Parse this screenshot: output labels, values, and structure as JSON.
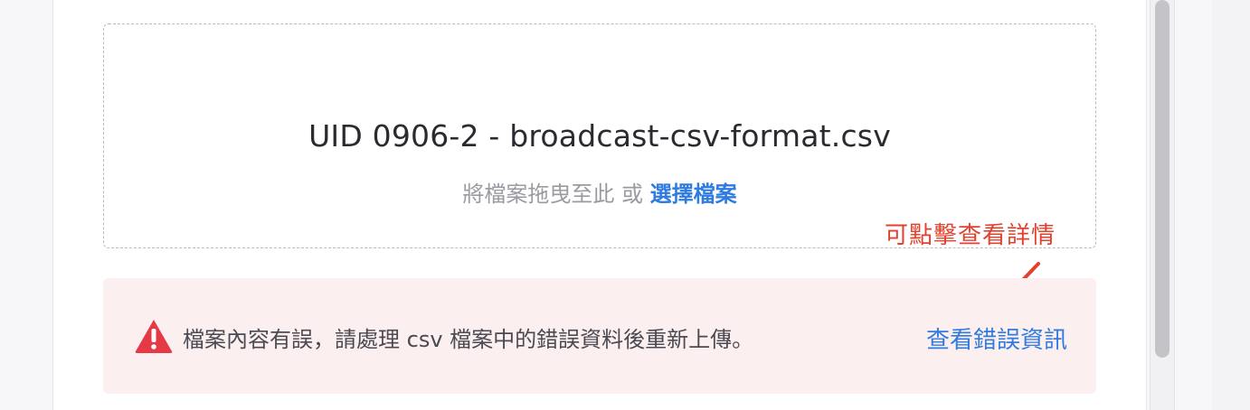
{
  "upload": {
    "file_name": "UID 0906-2 - broadcast-csv-format.csv",
    "drop_hint": "將檔案拖曳至此 或 ",
    "choose_file_label": "選擇檔案"
  },
  "annotation": {
    "text": "可點擊查看詳情",
    "color": "#e3402d"
  },
  "error_alert": {
    "icon": "warning-triangle-icon",
    "message": "檔案內容有誤，請處理 csv 檔案中的錯誤資料後重新上傳。",
    "link_label": "查看錯誤資訊",
    "background": "#fcefef",
    "accent": "#e63946",
    "link_color": "#2f7be0"
  }
}
